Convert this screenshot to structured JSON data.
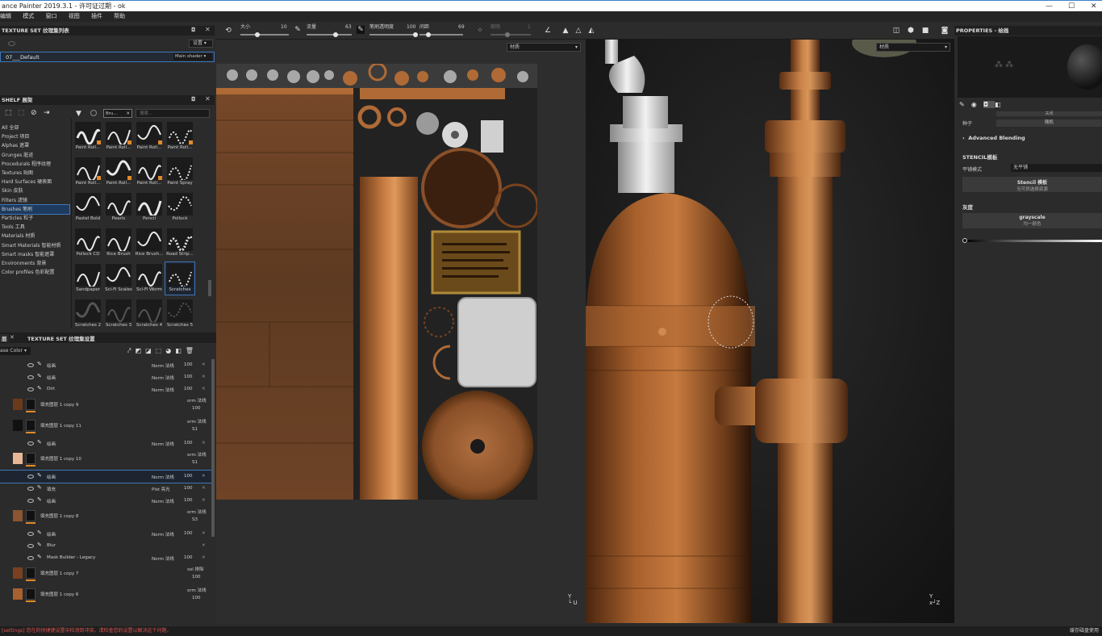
{
  "window": {
    "title": "ance Painter 2019.3.1 - 许可证过期 - ok"
  },
  "menu": [
    "编辑",
    "模式",
    "窗口",
    "视图",
    "插件",
    "帮助"
  ],
  "toolbar": {
    "size_label": "大小",
    "size_value": "10",
    "flow_label": "流量",
    "flow_value": "63",
    "opacity_label": "笔刷透明度",
    "opacity_value": "100",
    "spacing_label": "间距",
    "spacing_value": "69",
    "jitter_label": "跟随",
    "jitter_value": "1",
    "uv_dropdown": "材质",
    "view_dropdown": "材质"
  },
  "texture_set_list": {
    "header": "TEXTURE SET 纹理集列表",
    "settings_btn": "设置",
    "item_name": "07___Default",
    "item_shader": "Main shader"
  },
  "shelf": {
    "header": "SHELF 展架",
    "tab_label": "Bru...",
    "search_placeholder": "搜索...",
    "categories": [
      "All 全部",
      "Project 项目",
      "Alphas 遮罩",
      "Grunges 脏迹",
      "Procedurals 程序纹理",
      "Textures 贴图",
      "Hard Surfaces 硬表面",
      "Skin 皮肤",
      "Filters 滤镜",
      "Brushes 笔刷",
      "Particles 粒子",
      "Tools 工具",
      "Materials 材质",
      "Smart Materials 智能材质",
      "Smart masks 智能遮罩",
      "Environments 背景",
      "Color profiles 色彩配置"
    ],
    "selected_category": 9,
    "brushes": [
      "Paint Roll...",
      "Paint Roll...",
      "Paint Roll...",
      "Paint Roll...",
      "Paint Roll...",
      "Paint Roll...",
      "Paint Roll...",
      "Paint Spray",
      "Pastel Bold",
      "Pearls",
      "Pencil",
      "Pollock",
      "Pollock CD",
      "Rice Brush",
      "Rice Brush...",
      "Road Strip...",
      "Sandpaper",
      "Sci-Fi Scales",
      "Sci-Fi Worm",
      "Scratches",
      "Scratches 2",
      "Scratches 3",
      "Scratches 4",
      "Scratches 5"
    ],
    "selected_brush": 19
  },
  "layers_panel": {
    "tab1": "层",
    "tab2": "TEXTURE SET 纹理集设置",
    "channel": "ase Color",
    "rows": [
      {
        "type": "sub",
        "name": "绘画",
        "blend": "Norm 法线",
        "opacity": "100"
      },
      {
        "type": "sub",
        "name": "绘画",
        "blend": "Norm 法线",
        "opacity": "100"
      },
      {
        "type": "sub",
        "name": "Dirt",
        "blend": "Norm 法线",
        "opacity": "100"
      },
      {
        "type": "fill",
        "name": "填充图层 1 copy 9",
        "blend": "orm 法线",
        "opacity": "100"
      },
      {
        "type": "fill",
        "name": "填充图层 1 copy 11",
        "blend": "orm 法线",
        "opacity": "S1"
      },
      {
        "type": "sub",
        "name": "绘画",
        "blend": "Norm 法线",
        "opacity": "100"
      },
      {
        "type": "fill",
        "name": "填充图层 1 copy 10",
        "blend": "orm 法线",
        "opacity": "S1"
      },
      {
        "type": "sub",
        "name": "绘画",
        "blend": "Norm 法线",
        "opacity": "100",
        "selected": true
      },
      {
        "type": "sub",
        "name": "填充",
        "blend": "Plst 亮光",
        "opacity": "100"
      },
      {
        "type": "sub",
        "name": "绘画",
        "blend": "Norm 法线",
        "opacity": "100"
      },
      {
        "type": "fill",
        "name": "填充图层 1 copy 8",
        "blend": "orm 法线",
        "opacity": "S3"
      },
      {
        "type": "sub",
        "name": "绘画",
        "blend": "Norm 法线",
        "opacity": "100"
      },
      {
        "type": "sub",
        "name": "Blur",
        "blend": "",
        "opacity": ""
      },
      {
        "type": "sub",
        "name": "Mask Builder - Legacy",
        "blend": "Norm 法线",
        "opacity": "100"
      },
      {
        "type": "fill",
        "name": "填充图层 1 copy 7",
        "blend": "sol 排除",
        "opacity": "100"
      },
      {
        "type": "fill",
        "name": "填充图层 1 copy 6",
        "blend": "orm 法线",
        "opacity": "100"
      }
    ]
  },
  "properties": {
    "header": "PROPERTIES - 绘画",
    "seed_label": "种子",
    "seed_value": "随机",
    "top_value": "关闭",
    "advanced_blending": "Advanced Blending",
    "stencil_title": "STENCIL模板",
    "tiling_label": "平铺模式",
    "tiling_value": "无平铺",
    "stencil_btn": "Stencil 模板",
    "stencil_sub": "无可供选择资源",
    "gray_title": "灰度",
    "gray_btn": "grayscale",
    "gray_sub": "均一颜色"
  },
  "status": {
    "left": "[settings] 您在的快捷键设置中检测到冲突。请检查您的设置以解决这个问题。",
    "right": "缓存磁盘使用"
  },
  "colors": {
    "accent": "#3f76b8",
    "copper": "#b06a35",
    "error": "#d9534f"
  }
}
